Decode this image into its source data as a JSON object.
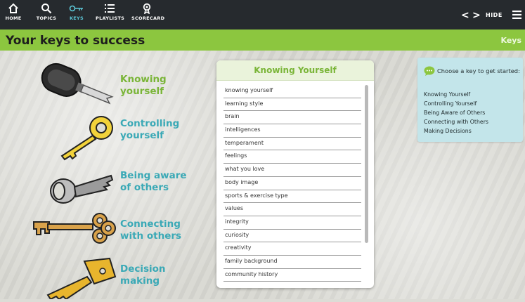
{
  "nav": {
    "items": [
      {
        "label": "HOME",
        "icon": "home-icon"
      },
      {
        "label": "TOPICS",
        "icon": "search-icon"
      },
      {
        "label": "KEYS",
        "icon": "key-icon",
        "active": true
      },
      {
        "label": "PLAYLISTS",
        "icon": "list-icon"
      },
      {
        "label": "SCORECARD",
        "icon": "ribbon-icon"
      }
    ],
    "prev_symbol": "<",
    "next_symbol": ">",
    "hide_label": "HIDE"
  },
  "title_bar": {
    "title": "Your keys to success",
    "section_label": "Keys"
  },
  "keys": [
    {
      "label_line1": "Knowing",
      "label_line2": "yourself",
      "color": "#7ab538"
    },
    {
      "label_line1": "Controlling",
      "label_line2": "yourself",
      "color": "#3aa9b6"
    },
    {
      "label_line1": "Being aware",
      "label_line2": "of others",
      "color": "#3aa9b6"
    },
    {
      "label_line1": "Connecting",
      "label_line2": "with others",
      "color": "#3aa9b6"
    },
    {
      "label_line1": "Decision",
      "label_line2": "making",
      "color": "#3aa9b6"
    }
  ],
  "list_panel": {
    "header": "Knowing Yourself",
    "items": [
      "knowing yourself",
      "learning style",
      "brain",
      "intelligences",
      "temperament",
      "feelings",
      "what you love",
      "body image",
      "sports & exercise type",
      "values",
      "integrity",
      "curiosity",
      "creativity",
      "family background",
      "community history"
    ]
  },
  "help": {
    "title": "Choose a key to get started:",
    "links": [
      "Knowing Yourself",
      "Controlling Yourself",
      "Being Aware of Others",
      "Connecting with Others",
      "Making Decisions"
    ]
  },
  "colors": {
    "topbar": "#262a2e",
    "accent_green": "#8cc63f",
    "accent_teal": "#3aa9b6",
    "active_nav": "#5cc6d6",
    "help_bg": "#c3e5ea"
  }
}
